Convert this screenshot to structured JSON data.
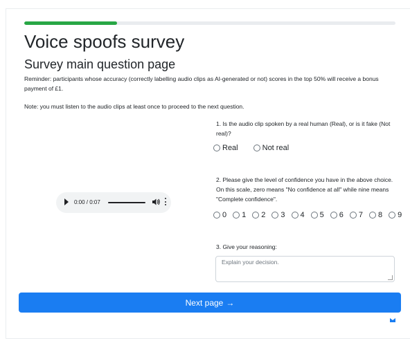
{
  "progress": {
    "fraction": 0.25,
    "color": "#28a745"
  },
  "page": {
    "title": "Voice spoofs survey",
    "subtitle": "Survey main question page",
    "reminder": "Reminder: participants whose accuracy (correctly labelling audio clips as AI-generated or not) scores in the top 50% will receive a bonus payment of £1.",
    "note": "Note: you must listen to the audio clips at least once to proceed to the next question."
  },
  "audio": {
    "time": "0:00 / 0:07",
    "icons": [
      "play-icon",
      "volume-icon",
      "more-options-icon"
    ]
  },
  "q1": {
    "text": "1. Is the audio clip spoken by a real human (Real), or is it fake (Not real)?",
    "options": [
      "Real",
      "Not real"
    ]
  },
  "q2": {
    "text": "2. Please give the level of confidence you have in the above choice. On this scale, zero means \"No confidence at all\" while nine means \"Complete confidence\".",
    "options": [
      "0",
      "1",
      "2",
      "3",
      "4",
      "5",
      "6",
      "7",
      "8",
      "9"
    ]
  },
  "q3": {
    "text": "3. Give your reasoning:",
    "placeholder": "Explain your decision."
  },
  "next_button": {
    "label": "Next page",
    "arrow": "→",
    "color": "#1a7df2"
  },
  "footer": {
    "icon": "mail-icon"
  }
}
